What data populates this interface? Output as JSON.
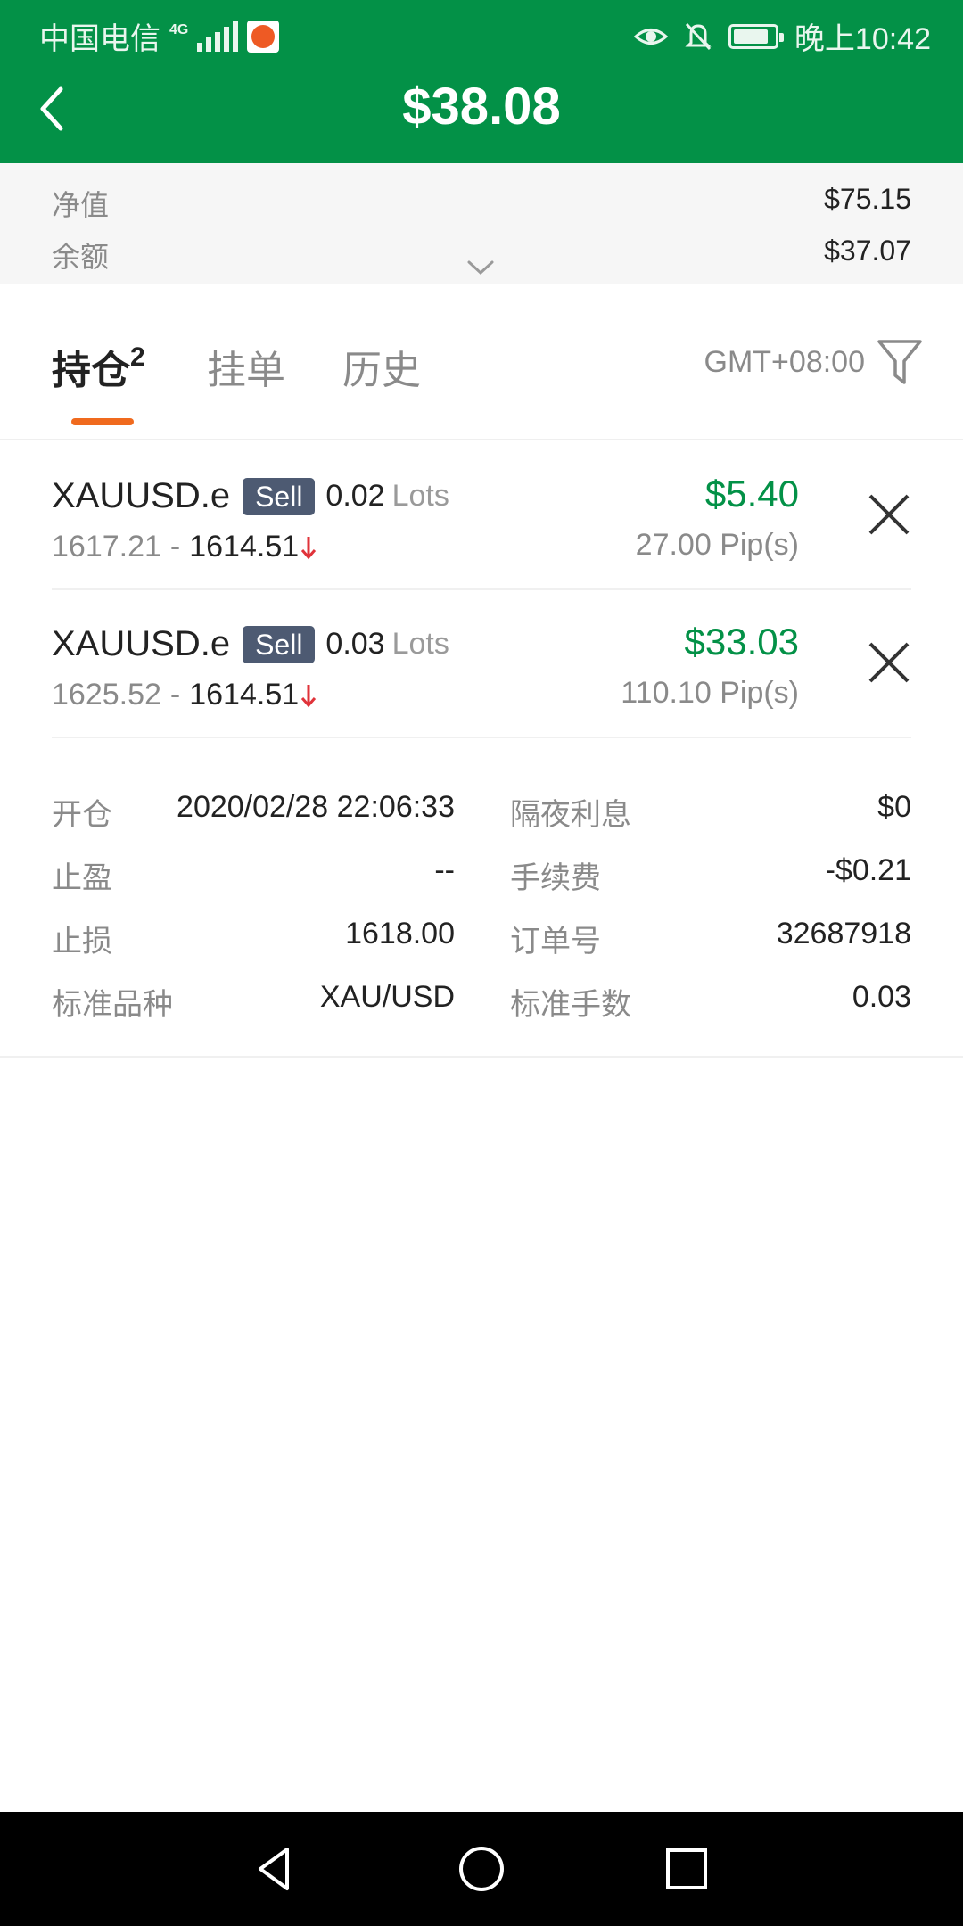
{
  "status_bar": {
    "carrier": "中国电信",
    "network": "4G",
    "time": "晚上10:42"
  },
  "header": {
    "title": "$38.08",
    "back_icon": "chevron-left-icon",
    "bg_color": "#039147"
  },
  "summary": {
    "equity_label": "净值",
    "equity_value": "$75.15",
    "balance_label": "余额",
    "balance_value": "$37.07"
  },
  "tabs": {
    "items": [
      {
        "label": "持仓",
        "count": "2",
        "active": true
      },
      {
        "label": "挂单",
        "active": false
      },
      {
        "label": "历史",
        "active": false
      }
    ],
    "timezone": "GMT+08:00"
  },
  "positions": [
    {
      "symbol": "XAUUSD.e",
      "side": "Sell",
      "lots": "0.02",
      "lots_unit": "Lots",
      "open_price": "1617.21",
      "separator": "-",
      "current_price": "1614.51",
      "pnl": "$5.40",
      "pips": "27.00 Pip(s)"
    },
    {
      "symbol": "XAUUSD.e",
      "side": "Sell",
      "lots": "0.03",
      "lots_unit": "Lots",
      "open_price": "1625.52",
      "separator": "-",
      "current_price": "1614.51",
      "pnl": "$33.03",
      "pips": "110.10 Pip(s)"
    }
  ],
  "details": {
    "left": [
      {
        "label": "开仓",
        "value": "2020/02/28 22:06:33"
      },
      {
        "label": "止盈",
        "value": "--"
      },
      {
        "label": "止损",
        "value": "1618.00"
      },
      {
        "label": "标准品种",
        "value": "XAU/USD"
      }
    ],
    "right": [
      {
        "label": "隔夜利息",
        "value": "$0"
      },
      {
        "label": "手续费",
        "value": "-$0.21"
      },
      {
        "label": "订单号",
        "value": "32687918"
      },
      {
        "label": "标准手数",
        "value": "0.03"
      }
    ]
  },
  "colors": {
    "profit": "#039147",
    "down_arrow": "#e0333a",
    "tab_underline": "#f06a1e",
    "sell_badge": "#4d5a72"
  }
}
